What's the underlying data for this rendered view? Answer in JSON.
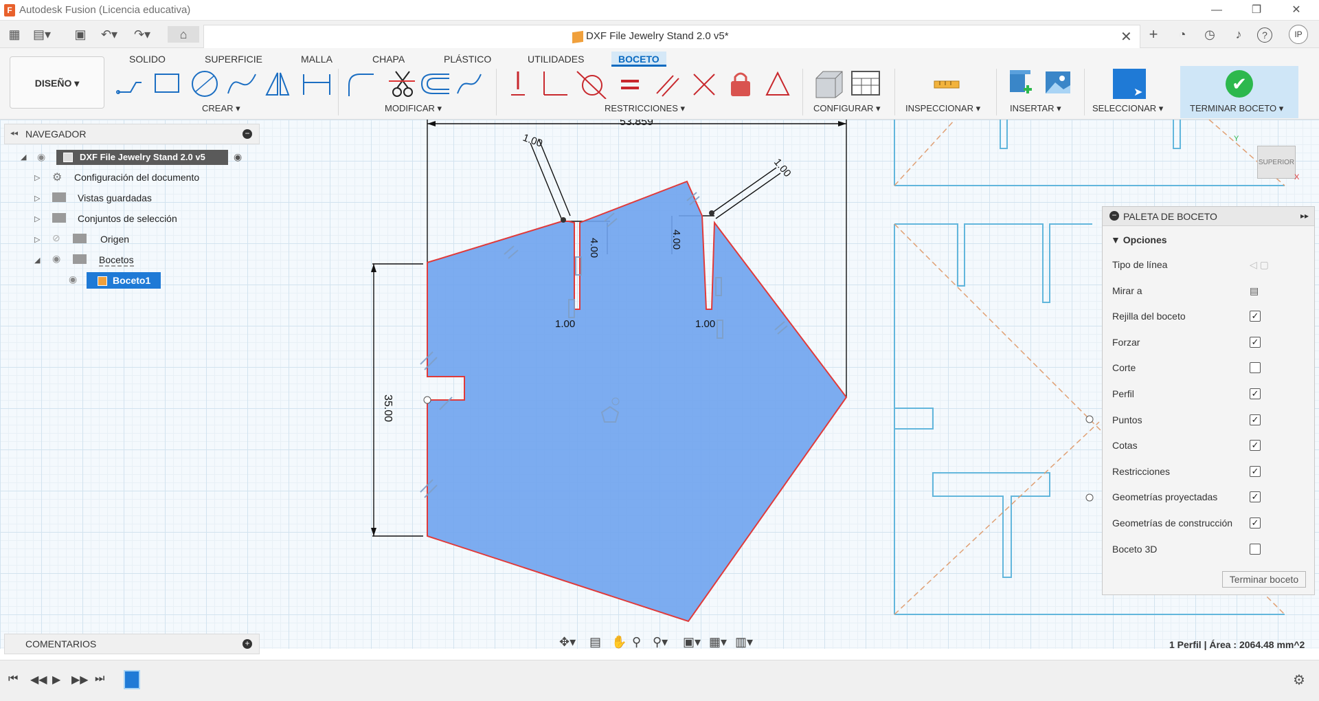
{
  "app": {
    "logo": "F",
    "title": "Autodesk Fusion (Licencia educativa)"
  },
  "window": {
    "minimize": "—",
    "restore": "❐",
    "close": "✕"
  },
  "document": {
    "title": "DXF File Jewelry Stand 2.0 v5*",
    "close": "✕"
  },
  "quickbar": {
    "avatar": "IP",
    "help": "?"
  },
  "workspace": {
    "label": "DISEÑO ▾"
  },
  "ribbon": {
    "tabs": [
      "SOLIDO",
      "SUPERFICIE",
      "MALLA",
      "CHAPA",
      "PLÁSTICO",
      "UTILIDADES",
      "BOCETO"
    ],
    "active_tab": "BOCETO",
    "groups": {
      "crear": "CREAR ▾",
      "modificar": "MODIFICAR ▾",
      "restricciones": "RESTRICCIONES ▾",
      "configurar": "CONFIGURAR ▾",
      "inspeccionar": "INSPECCIONAR ▾",
      "insertar": "INSERTAR ▾",
      "seleccionar": "SELECCIONAR ▾",
      "terminar": "TERMINAR BOCETO ▾"
    }
  },
  "browser": {
    "title": "NAVEGADOR",
    "root": "DXF File Jewelry Stand 2.0 v5",
    "items": [
      {
        "label": "Configuración del documento"
      },
      {
        "label": "Vistas guardadas"
      },
      {
        "label": "Conjuntos de selección"
      },
      {
        "label": "Origen"
      },
      {
        "label": "Bocetos"
      },
      {
        "label": "Boceto1"
      }
    ]
  },
  "comments": {
    "title": "COMENTARIOS"
  },
  "sketch": {
    "dims": {
      "width": "53.859",
      "height": "35.00",
      "slot_w1": "1.00",
      "slot_w2": "1.00",
      "depth1": "4.00",
      "depth2": "4.00",
      "bot1": "1.00",
      "bot2": "1.00"
    }
  },
  "viewcube": {
    "face": "SUPERIOR",
    "axis_x": "X",
    "axis_y": "Y"
  },
  "palette": {
    "title": "PALETA DE BOCETO",
    "section": "Opciones",
    "options": [
      {
        "label": "Tipo de línea",
        "control": "icon"
      },
      {
        "label": "Mirar a",
        "control": "icon"
      },
      {
        "label": "Rejilla del boceto",
        "checked": true
      },
      {
        "label": "Forzar",
        "checked": true
      },
      {
        "label": "Corte",
        "checked": false
      },
      {
        "label": "Perfil",
        "checked": true
      },
      {
        "label": "Puntos",
        "checked": true
      },
      {
        "label": "Cotas",
        "checked": true
      },
      {
        "label": "Restricciones",
        "checked": true
      },
      {
        "label": "Geometrías proyectadas",
        "checked": true
      },
      {
        "label": "Geometrías de construcción",
        "checked": true
      },
      {
        "label": "Boceto 3D",
        "checked": false
      }
    ],
    "finish_button": "Terminar boceto"
  },
  "status": {
    "text": "1 Perfil | Área : 2064.48 mm^2"
  },
  "colors": {
    "accent": "#0a6ac0",
    "profile": "#6fa3ee",
    "finish": "#2db84d"
  }
}
